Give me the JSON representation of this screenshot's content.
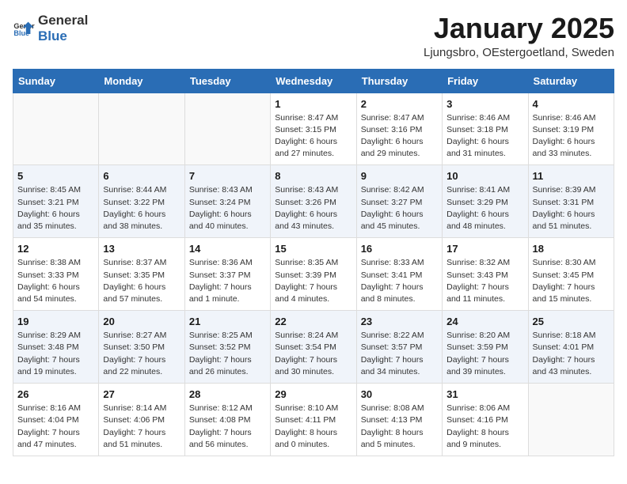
{
  "header": {
    "logo_general": "General",
    "logo_blue": "Blue",
    "title": "January 2025",
    "subtitle": "Ljungsbro, OEstergoetland, Sweden"
  },
  "weekdays": [
    "Sunday",
    "Monday",
    "Tuesday",
    "Wednesday",
    "Thursday",
    "Friday",
    "Saturday"
  ],
  "weeks": [
    [
      {
        "day": "",
        "info": ""
      },
      {
        "day": "",
        "info": ""
      },
      {
        "day": "",
        "info": ""
      },
      {
        "day": "1",
        "info": "Sunrise: 8:47 AM\nSunset: 3:15 PM\nDaylight: 6 hours and 27 minutes."
      },
      {
        "day": "2",
        "info": "Sunrise: 8:47 AM\nSunset: 3:16 PM\nDaylight: 6 hours and 29 minutes."
      },
      {
        "day": "3",
        "info": "Sunrise: 8:46 AM\nSunset: 3:18 PM\nDaylight: 6 hours and 31 minutes."
      },
      {
        "day": "4",
        "info": "Sunrise: 8:46 AM\nSunset: 3:19 PM\nDaylight: 6 hours and 33 minutes."
      }
    ],
    [
      {
        "day": "5",
        "info": "Sunrise: 8:45 AM\nSunset: 3:21 PM\nDaylight: 6 hours and 35 minutes."
      },
      {
        "day": "6",
        "info": "Sunrise: 8:44 AM\nSunset: 3:22 PM\nDaylight: 6 hours and 38 minutes."
      },
      {
        "day": "7",
        "info": "Sunrise: 8:43 AM\nSunset: 3:24 PM\nDaylight: 6 hours and 40 minutes."
      },
      {
        "day": "8",
        "info": "Sunrise: 8:43 AM\nSunset: 3:26 PM\nDaylight: 6 hours and 43 minutes."
      },
      {
        "day": "9",
        "info": "Sunrise: 8:42 AM\nSunset: 3:27 PM\nDaylight: 6 hours and 45 minutes."
      },
      {
        "day": "10",
        "info": "Sunrise: 8:41 AM\nSunset: 3:29 PM\nDaylight: 6 hours and 48 minutes."
      },
      {
        "day": "11",
        "info": "Sunrise: 8:39 AM\nSunset: 3:31 PM\nDaylight: 6 hours and 51 minutes."
      }
    ],
    [
      {
        "day": "12",
        "info": "Sunrise: 8:38 AM\nSunset: 3:33 PM\nDaylight: 6 hours and 54 minutes."
      },
      {
        "day": "13",
        "info": "Sunrise: 8:37 AM\nSunset: 3:35 PM\nDaylight: 6 hours and 57 minutes."
      },
      {
        "day": "14",
        "info": "Sunrise: 8:36 AM\nSunset: 3:37 PM\nDaylight: 7 hours and 1 minute."
      },
      {
        "day": "15",
        "info": "Sunrise: 8:35 AM\nSunset: 3:39 PM\nDaylight: 7 hours and 4 minutes."
      },
      {
        "day": "16",
        "info": "Sunrise: 8:33 AM\nSunset: 3:41 PM\nDaylight: 7 hours and 8 minutes."
      },
      {
        "day": "17",
        "info": "Sunrise: 8:32 AM\nSunset: 3:43 PM\nDaylight: 7 hours and 11 minutes."
      },
      {
        "day": "18",
        "info": "Sunrise: 8:30 AM\nSunset: 3:45 PM\nDaylight: 7 hours and 15 minutes."
      }
    ],
    [
      {
        "day": "19",
        "info": "Sunrise: 8:29 AM\nSunset: 3:48 PM\nDaylight: 7 hours and 19 minutes."
      },
      {
        "day": "20",
        "info": "Sunrise: 8:27 AM\nSunset: 3:50 PM\nDaylight: 7 hours and 22 minutes."
      },
      {
        "day": "21",
        "info": "Sunrise: 8:25 AM\nSunset: 3:52 PM\nDaylight: 7 hours and 26 minutes."
      },
      {
        "day": "22",
        "info": "Sunrise: 8:24 AM\nSunset: 3:54 PM\nDaylight: 7 hours and 30 minutes."
      },
      {
        "day": "23",
        "info": "Sunrise: 8:22 AM\nSunset: 3:57 PM\nDaylight: 7 hours and 34 minutes."
      },
      {
        "day": "24",
        "info": "Sunrise: 8:20 AM\nSunset: 3:59 PM\nDaylight: 7 hours and 39 minutes."
      },
      {
        "day": "25",
        "info": "Sunrise: 8:18 AM\nSunset: 4:01 PM\nDaylight: 7 hours and 43 minutes."
      }
    ],
    [
      {
        "day": "26",
        "info": "Sunrise: 8:16 AM\nSunset: 4:04 PM\nDaylight: 7 hours and 47 minutes."
      },
      {
        "day": "27",
        "info": "Sunrise: 8:14 AM\nSunset: 4:06 PM\nDaylight: 7 hours and 51 minutes."
      },
      {
        "day": "28",
        "info": "Sunrise: 8:12 AM\nSunset: 4:08 PM\nDaylight: 7 hours and 56 minutes."
      },
      {
        "day": "29",
        "info": "Sunrise: 8:10 AM\nSunset: 4:11 PM\nDaylight: 8 hours and 0 minutes."
      },
      {
        "day": "30",
        "info": "Sunrise: 8:08 AM\nSunset: 4:13 PM\nDaylight: 8 hours and 5 minutes."
      },
      {
        "day": "31",
        "info": "Sunrise: 8:06 AM\nSunset: 4:16 PM\nDaylight: 8 hours and 9 minutes."
      },
      {
        "day": "",
        "info": ""
      }
    ]
  ]
}
